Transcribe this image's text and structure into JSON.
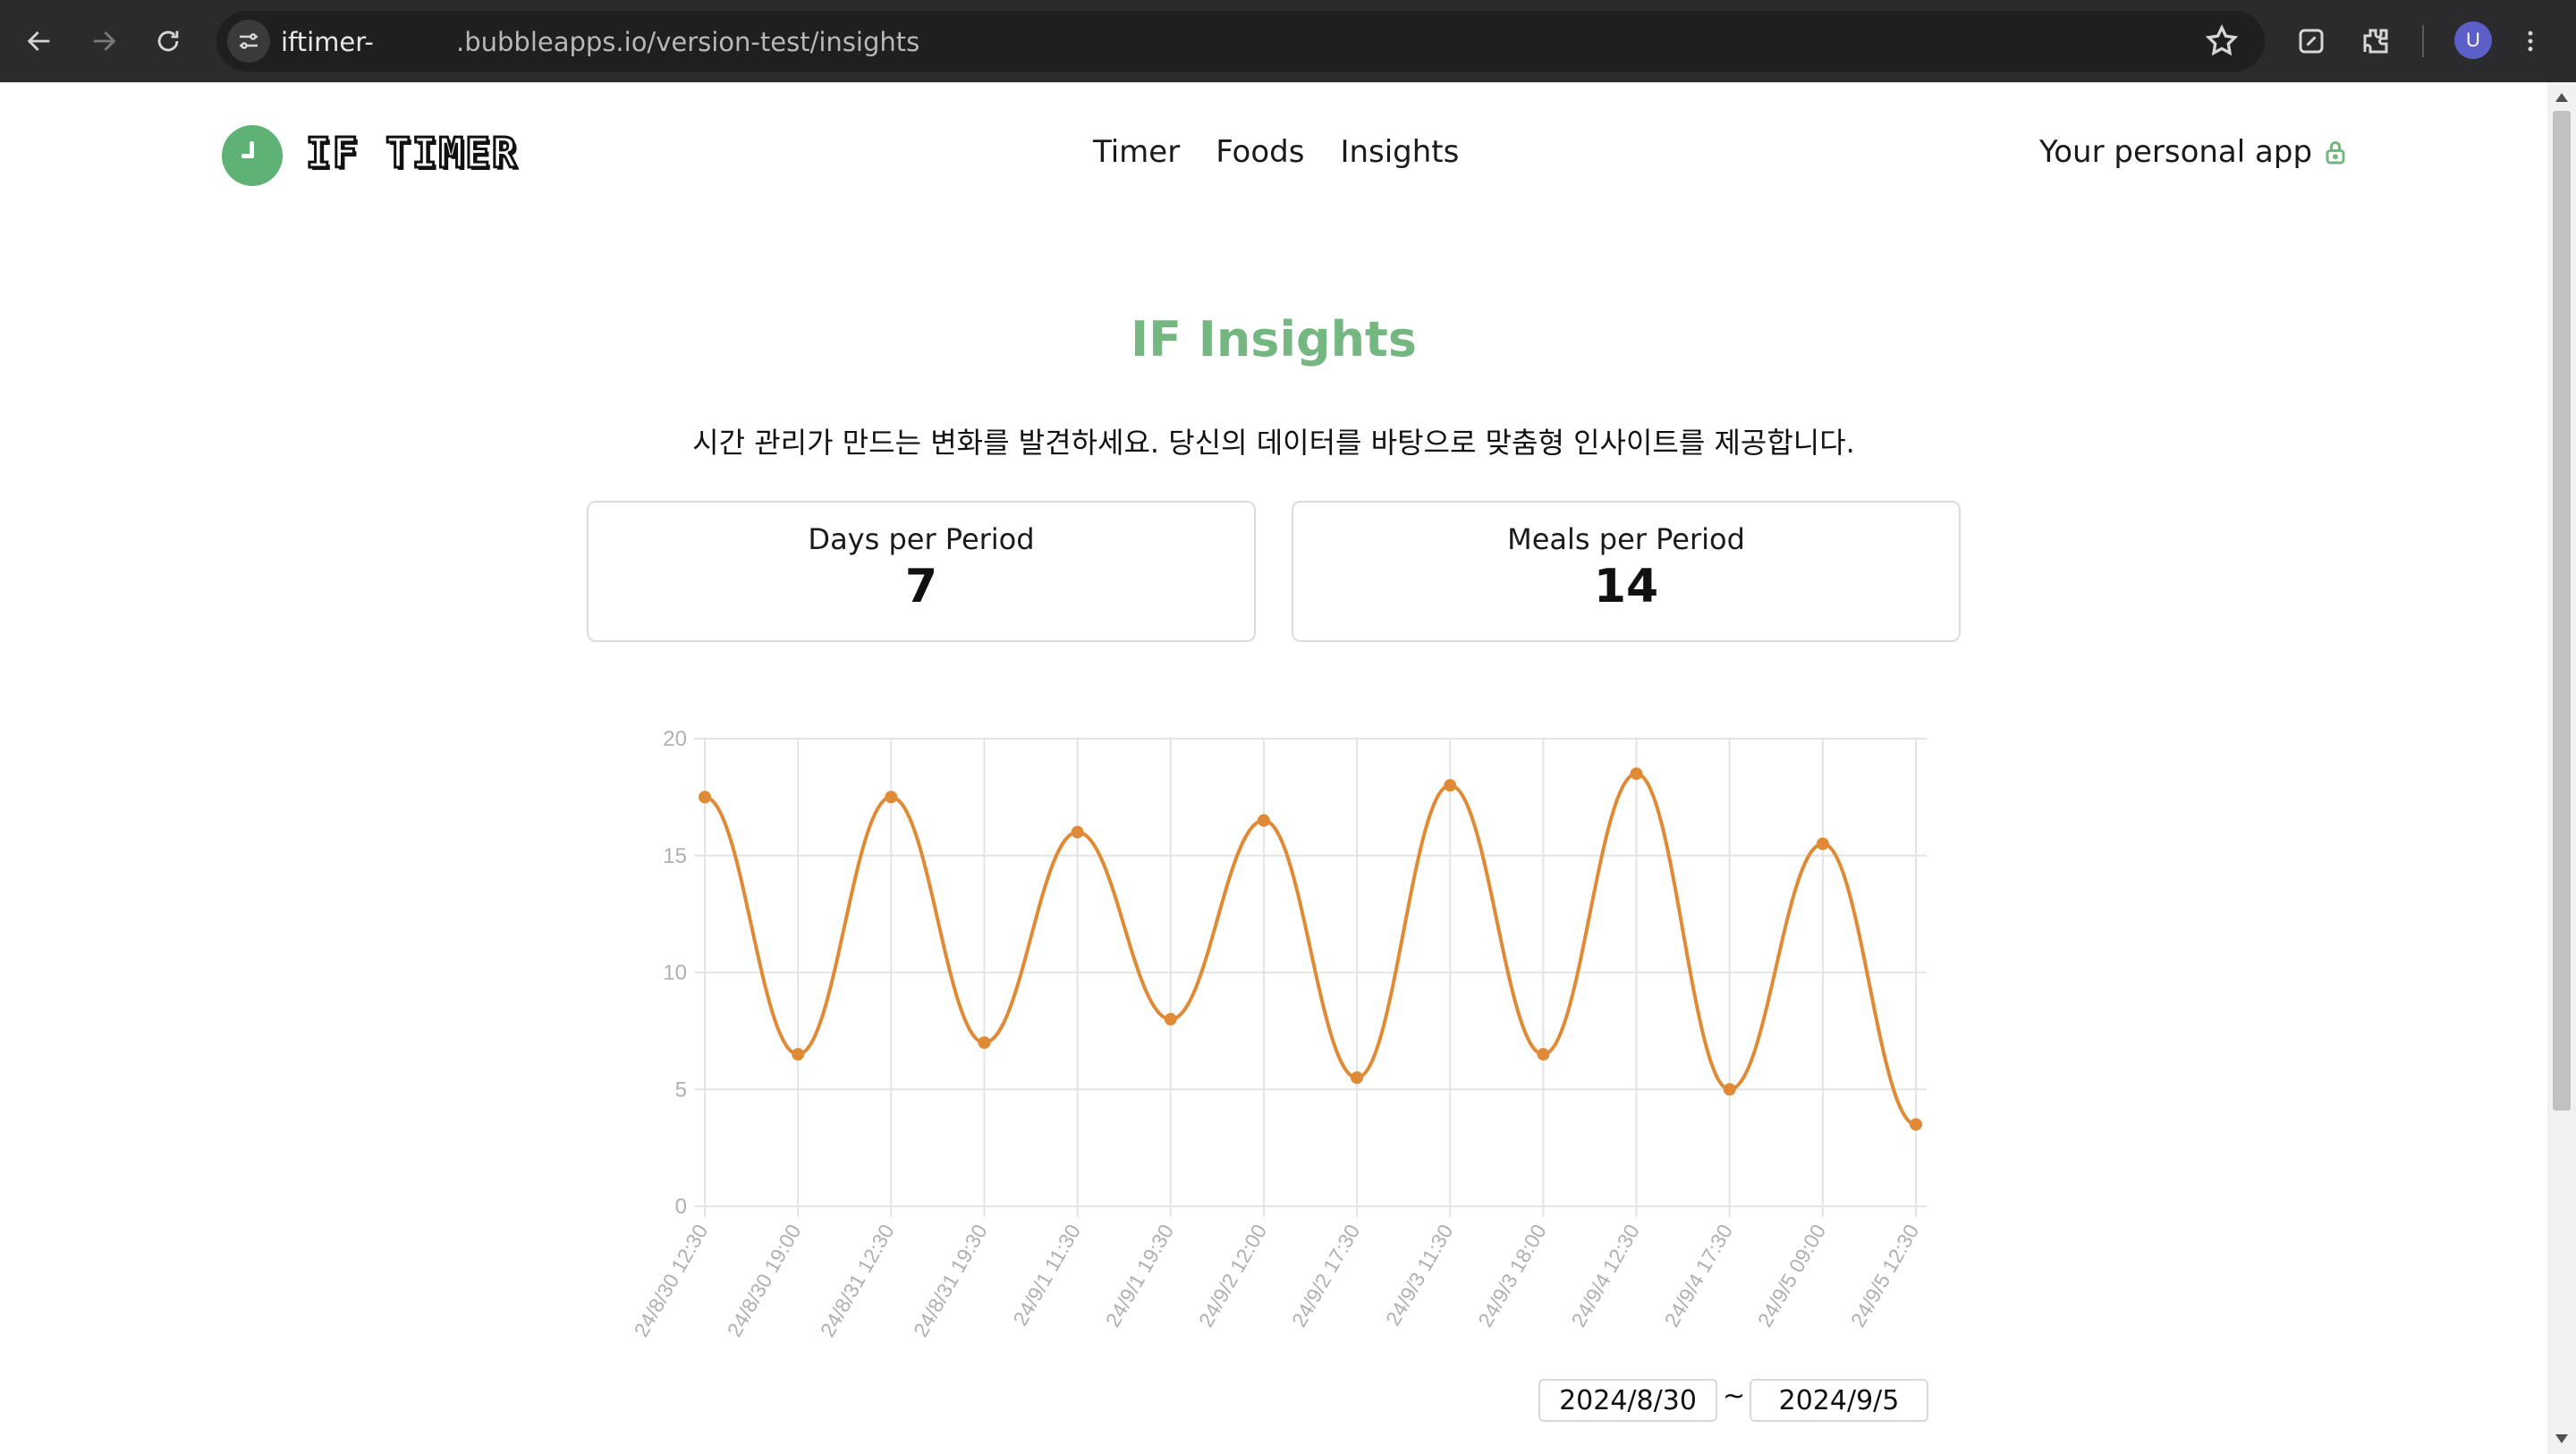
{
  "browser": {
    "url_host": "iftimer-",
    "url_rest": ".bubbleapps.io/version-test/insights",
    "profile_initial": "U"
  },
  "header": {
    "logo_text": "IF TIMER",
    "nav": [
      "Timer",
      "Foods",
      "Insights"
    ],
    "personal_label": "Your personal app"
  },
  "page": {
    "title": "IF Insights",
    "subtitle": "시간 관리가 만드는 변화를 발견하세요. 당신의 데이터를 바탕으로 맞춤형 인사이트를 제공합니다."
  },
  "stats": [
    {
      "label": "Days per Period",
      "value": "7"
    },
    {
      "label": "Meals per Period",
      "value": "14"
    }
  ],
  "colors": {
    "accent_green": "#74b780",
    "line": "#e08a35",
    "grid": "#e4e4e4",
    "tick": "#b0b0b0"
  },
  "chart_data": {
    "type": "line",
    "x": [
      "24/8/30 12:30",
      "24/8/30 19:00",
      "24/8/31 12:30",
      "24/8/31 19:30",
      "24/9/1 11:30",
      "24/9/1 19:30",
      "24/9/2 12:00",
      "24/9/2 17:30",
      "24/9/3 11:30",
      "24/9/3 18:00",
      "24/9/4 12:30",
      "24/9/4 17:30",
      "24/9/5 09:00",
      "24/9/5 12:30"
    ],
    "values": [
      17.5,
      6.5,
      17.5,
      7,
      16,
      8,
      16.5,
      5.5,
      18,
      6.5,
      18.5,
      5,
      15.5,
      3.5
    ],
    "yticks": [
      0,
      5,
      10,
      15,
      20
    ],
    "ylim": [
      0,
      20
    ],
    "grid": true,
    "legend": "none"
  },
  "date_range": {
    "start": "2024/8/30",
    "separator": "~",
    "end": "2024/9/5"
  }
}
